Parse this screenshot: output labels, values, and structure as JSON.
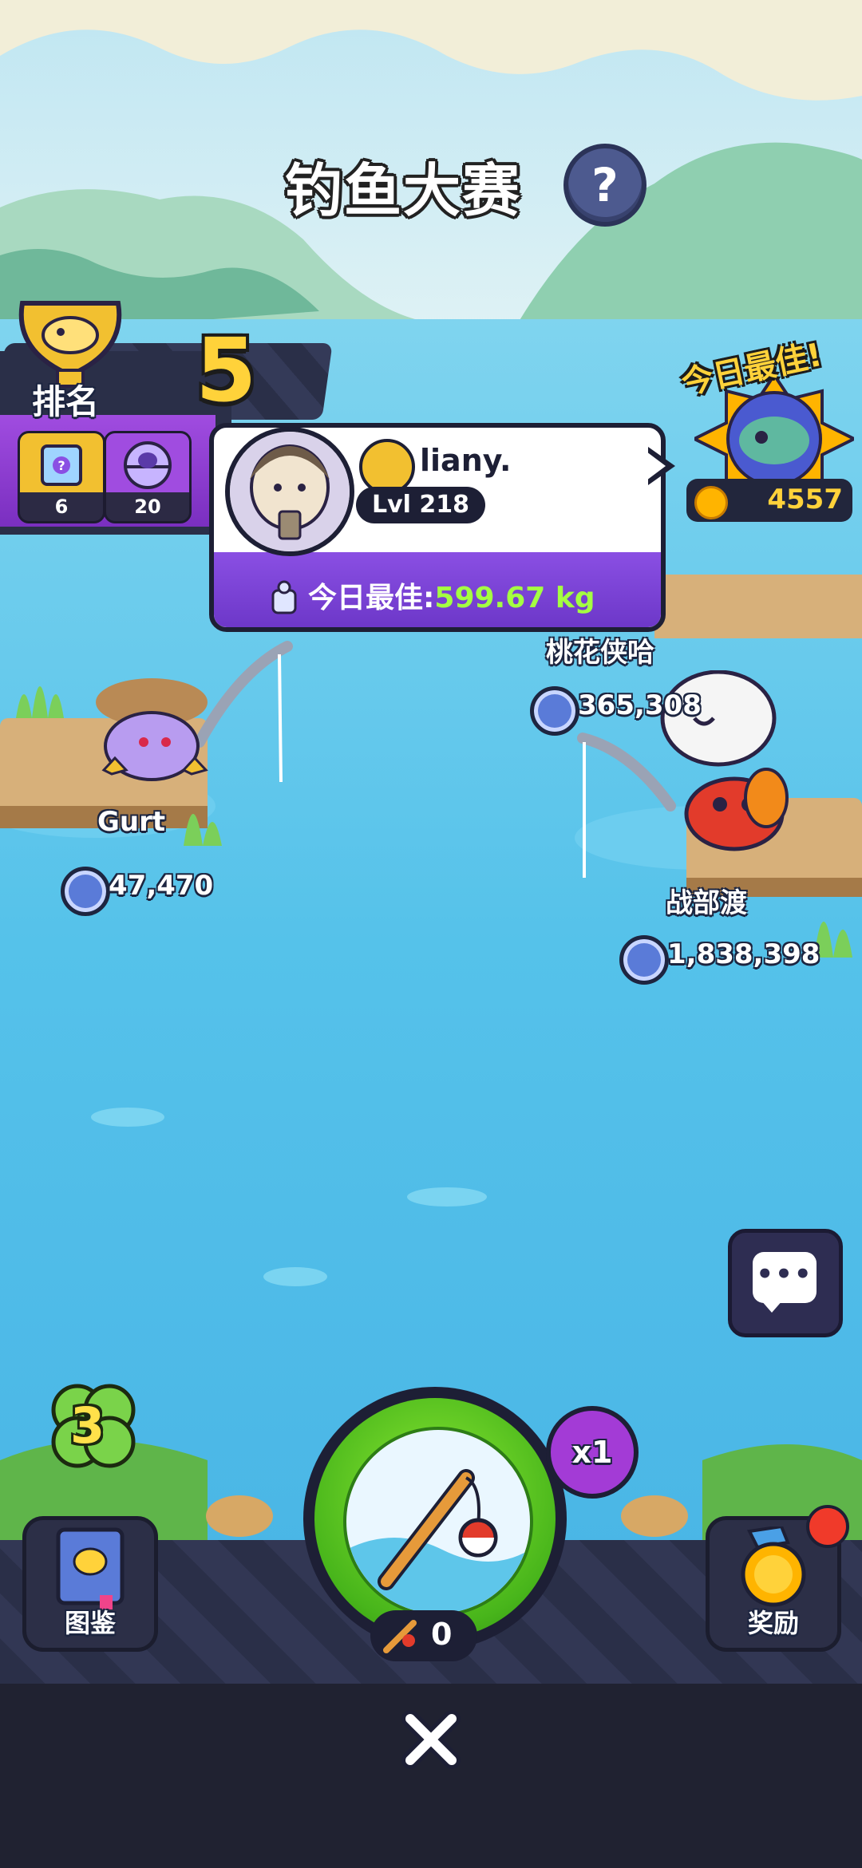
{
  "header": {
    "title": "钓鱼大赛",
    "help_icon": "?"
  },
  "ranking": {
    "label": "排名",
    "position": "5",
    "items": [
      {
        "icon": "mystery-box-icon",
        "count": "6"
      },
      {
        "icon": "capsule-icon",
        "count": "20"
      }
    ]
  },
  "player_card": {
    "username": "liany.",
    "level": "Lvl 218",
    "best_label": "今日最佳:",
    "best_value": "599.67 kg"
  },
  "today_best": {
    "label": "今日最佳!",
    "coins": "4557"
  },
  "players": [
    {
      "name": "Gurt",
      "score": "47,470"
    },
    {
      "name": "桃花侠哈",
      "score": "365,308"
    },
    {
      "name": "战部渡",
      "score": "1,838,398"
    }
  ],
  "controls": {
    "clover_count": "3",
    "collection_label": "图鉴",
    "rewards_label": "奖励",
    "multiplier": "x1",
    "bait_count": "0"
  },
  "colors": {
    "water": "#5ec6ea",
    "accent_green": "#48b51b",
    "gold": "#ffd23a",
    "panel_dark": "#2a2f48",
    "purple": "#8a4fe3",
    "best_value": "#a4ff42"
  }
}
